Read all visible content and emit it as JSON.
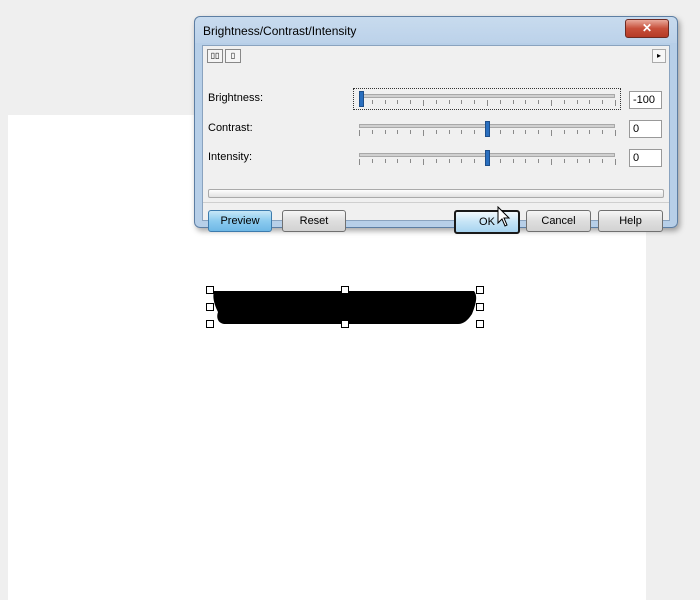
{
  "dialog": {
    "title": "Brightness/Contrast/Intensity",
    "close_symbol": "✕",
    "toolbar": {
      "tool1_icon": "compare-icon",
      "tool1_glyph": "▯▯",
      "tool2_icon": "single-view-icon",
      "tool2_glyph": "▯",
      "expand_icon": "triangle-right-icon",
      "expand_glyph": "▸"
    },
    "rows": [
      {
        "label": "Brightness:",
        "value": "-100",
        "position": 0.0
      },
      {
        "label": "Contrast:",
        "value": "0",
        "position": 0.5
      },
      {
        "label": "Intensity:",
        "value": "0",
        "position": 0.5
      }
    ],
    "progress": 0,
    "buttons": {
      "preview": "Preview",
      "reset": "Reset",
      "ok": "OK",
      "cancel": "Cancel",
      "help": "Help"
    }
  },
  "colors": {
    "accent": "#2a6fbf",
    "title_bar": "#bcd2ea",
    "close": "#c74f3a",
    "shape_fill": "#000000"
  }
}
